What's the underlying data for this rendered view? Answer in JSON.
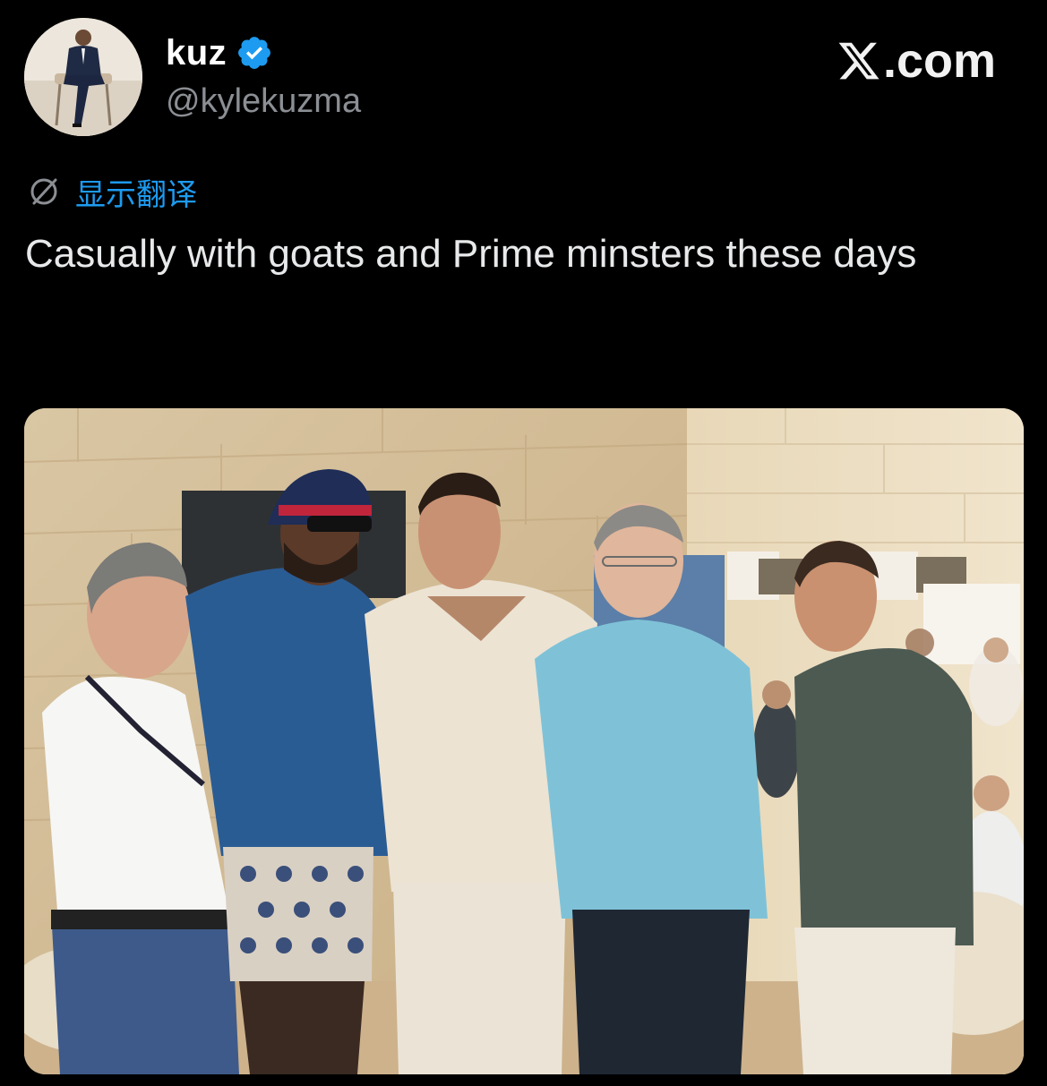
{
  "author": {
    "display_name": "kuz",
    "handle": "@kylekuzma",
    "verified": true,
    "avatar_icon": "user-avatar"
  },
  "brand": {
    "text": ".com",
    "mark": "X"
  },
  "translate": {
    "icon": "globe-icon",
    "label": "显示翻译"
  },
  "tweet": {
    "text": "Casually with goats and Prime minsters these days"
  },
  "media": {
    "icon": "photo",
    "people_count": 5
  },
  "colors": {
    "background": "#000000",
    "link": "#1d9bf0",
    "verified": "#1d9bf0",
    "muted": "#8b8f94"
  }
}
